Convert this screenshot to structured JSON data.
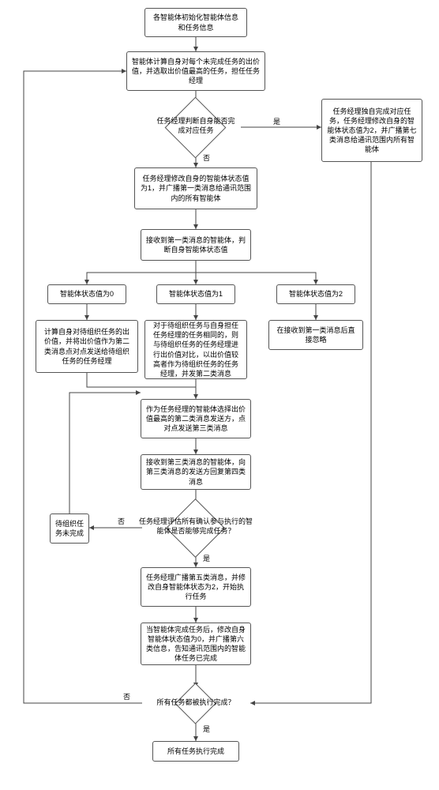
{
  "flow": {
    "n1": "各智能体初始化智能体信息和任务信息",
    "n2": "智能体计算自身对每个未完成任务的出价值，并选取出价值最高的任务，担任任务经理",
    "d1": "任务经理判断自身能否完成对应任务",
    "n3r": "任务经理独自完成对应任务，任务经理修改自身的智能体状态值为2，并广播第七类消息给通讯范围内所有智能体",
    "n4": "任务经理修改自身的智能体状态值为1，并广播第一类消息给通讯范围内的所有智能体",
    "n5": "接收到第一类消息的智能体，判断自身智能体状态值",
    "n6a": "智能体状态值为0",
    "n6b": "智能体状态值为1",
    "n6c": "智能体状态值为2",
    "n7a": "计算自身对待组织任务的出价值，并将出价值作为第二类消息点对点发送给待组织任务的任务经理",
    "n7b": "对于待组织任务与自身担任任务经理的任务相同的，则与待组织任务的任务经理进行出价值对比，以出价值较高者作为待组织任务的任务经理，并发第二类消息",
    "n7c": "在接收到第一类消息后直接忽略",
    "n8": "作为任务经理的智能体选择出价值最高的第二类消息发送方，点对点发送第三类消息",
    "n9": "接收到第三类消息的智能体，向第三类消息的发送方回复第四类消息",
    "d2": "任务经理评估所有确认参与执行的智能体是否能够完成任务？",
    "n10l": "待组织任务未完成",
    "n11": "任务经理广播第五类消息，并修改自身智能体状态为2，开始执行任务",
    "n12": "当智能体完成任务后，修改自身智能体状态值为0，并广播第六类信息，告知通讯范围内的智能体任务已完成",
    "d3": "所有任务都被执行完成？",
    "n13": "所有任务执行完成",
    "yes": "是",
    "no": "否"
  }
}
